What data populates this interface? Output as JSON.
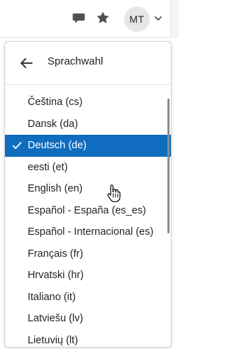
{
  "header": {
    "avatar_initials": "MT",
    "icons": [
      "chat-icon",
      "star-icon",
      "chevron-down-icon"
    ]
  },
  "panel": {
    "title": "Sprachwahl",
    "back_icon": "arrow-left-icon"
  },
  "languages": {
    "items": [
      {
        "label": "Čeština (cs)"
      },
      {
        "label": "Dansk (da)"
      },
      {
        "label": "Deutsch (de)",
        "selected": true
      },
      {
        "label": "eesti (et)"
      },
      {
        "label": "English (en)"
      },
      {
        "label": "Español - España (es_es)"
      },
      {
        "label": "Español - Internacional (es)"
      },
      {
        "label": "Français (fr)"
      },
      {
        "label": "Hrvatski (hr)"
      },
      {
        "label": "Italiano (it)"
      },
      {
        "label": "Latviešu (lv)"
      },
      {
        "label": "Lietuvių (lt)"
      }
    ]
  },
  "colors": {
    "selected_bg": "#0f6cbf",
    "selected_text": "#ffffff",
    "text": "#1d2125",
    "icon": "#505050"
  }
}
